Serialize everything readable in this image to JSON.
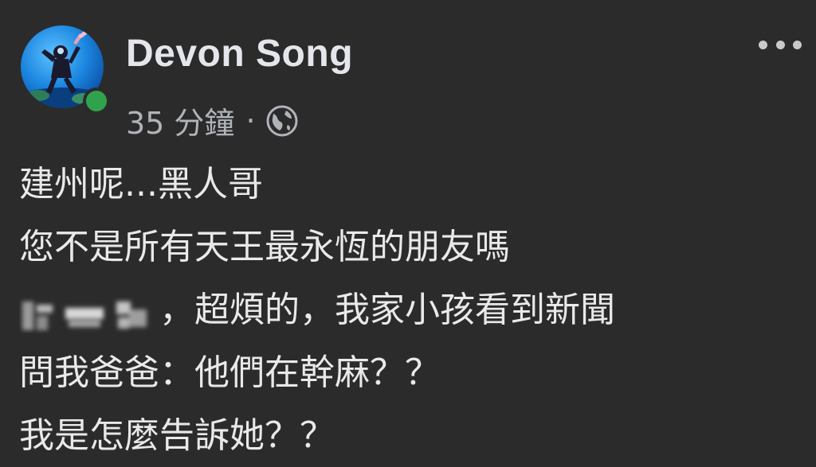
{
  "post": {
    "author_name": "Devon Song",
    "timestamp": "35 分鐘",
    "separator": "·",
    "privacy_icon": "globe-icon",
    "more_icon": "more-options-icon",
    "online_color": "#31a24c",
    "lines": [
      "建州呢...黑人哥",
      "您不是所有天王最永恆的朋友嗎",
      "，超煩的，我家小孩看到新聞",
      "問我爸爸：他們在幹麻？？",
      "我是怎麼告訴她？？"
    ]
  }
}
